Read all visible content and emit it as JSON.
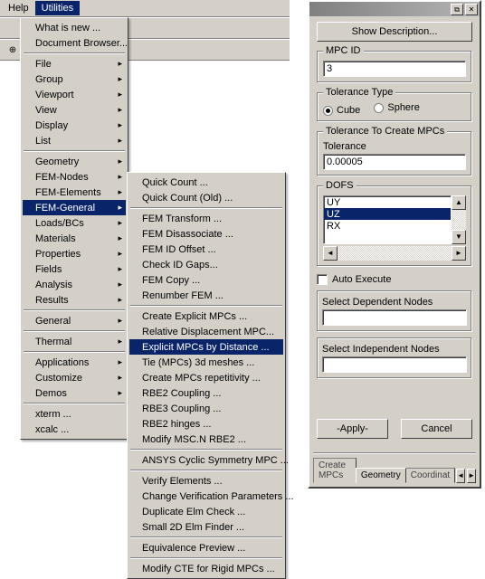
{
  "menubar": {
    "help": "Help",
    "utilities": "Utilities"
  },
  "menu1": {
    "whatsnew": "What is new ...",
    "docbrowser": "Document Browser...",
    "file": "File",
    "group": "Group",
    "viewport": "Viewport",
    "view": "View",
    "display": "Display",
    "list": "List",
    "geometry": "Geometry",
    "femnodes": "FEM-Nodes",
    "femelements": "FEM-Elements",
    "femgeneral": "FEM-General",
    "loadsbcs": "Loads/BCs",
    "materials": "Materials",
    "properties": "Properties",
    "fields": "Fields",
    "analysis": "Analysis",
    "results": "Results",
    "general": "General",
    "thermal": "Thermal",
    "applications": "Applications",
    "customize": "Customize",
    "demos": "Demos",
    "xterm": "xterm ...",
    "xcalc": "xcalc ..."
  },
  "menu2": {
    "quickcount": "Quick Count ...",
    "quickcountold": "Quick Count (Old) ...",
    "femtransform": "FEM Transform ...",
    "femdisassociate": "FEM Disassociate ...",
    "femidoffset": "FEM ID Offset ...",
    "checkidgaps": "Check ID Gaps...",
    "femcopy": "FEM Copy ...",
    "renumberfem": "Renumber FEM ...",
    "createexplicit": "Create Explicit MPCs ...",
    "reldisp": "Relative Displacement MPC...",
    "explicitbydist": "Explicit MPCs by Distance ...",
    "tie3d": "Tie (MPCs) 3d meshes ...",
    "createrep": "Create MPCs repetitivity ...",
    "rbe2coupling": "RBE2 Coupling ...",
    "rbe3coupling": "RBE3 Coupling ...",
    "rbe2hinges": "RBE2 hinges ...",
    "modifymscn": "Modify MSC.N RBE2 ...",
    "ansyscyclic": "ANSYS Cyclic Symmetry MPC ...",
    "verifyelem": "Verify Elements ...",
    "changeverif": "Change Verification Parameters ...",
    "dupelmcheck": "Duplicate Elm Check ...",
    "small2d": "Small 2D Elm Finder ...",
    "equivprev": "Equivalence Preview ...",
    "modifycte": "Modify CTE for Rigid MPCs ..."
  },
  "dialog": {
    "showdesc": "Show Description...",
    "mpcid_label": "MPC ID",
    "mpcid_value": "3",
    "toltype_label": "Tolerance Type",
    "radio_cube": "Cube",
    "radio_sphere": "Sphere",
    "tolcreate_label": "Tolerance To Create MPCs",
    "tolerance_label": "Tolerance",
    "tolerance_value": "0.00005",
    "dofs_label": "DOFS",
    "dofs": {
      "uy": "UY",
      "uz": "UZ",
      "rx": "RX"
    },
    "autoexec": "Auto Execute",
    "sel_dep": "Select Dependent Nodes",
    "sel_indep": "Select Independent Nodes",
    "apply": "-Apply-",
    "cancel": "Cancel",
    "tabs": {
      "create": "Create MPCs",
      "geometry": "Geometry",
      "coord": "Coordinat"
    }
  }
}
